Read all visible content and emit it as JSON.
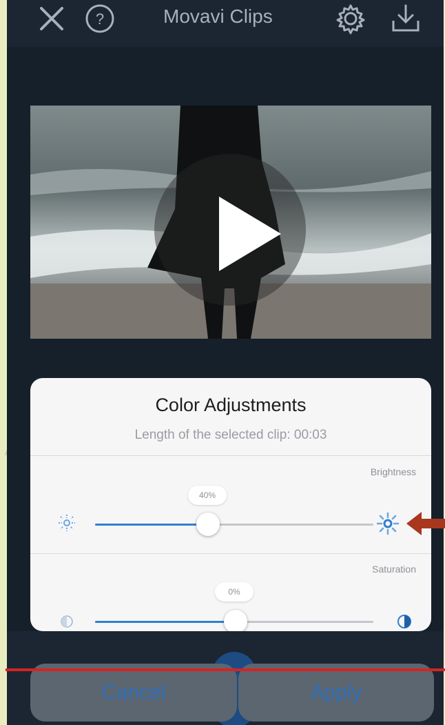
{
  "app": {
    "title": "Movavi Clips"
  },
  "header": {
    "icons": [
      "close-icon",
      "help-icon",
      "gear-icon",
      "download-icon"
    ]
  },
  "video": {
    "play_icon": "play-icon"
  },
  "panel": {
    "title": "Color Adjustments",
    "subtitle": "Length of the selected clip: 00:03",
    "sliders": [
      {
        "label": "Brightness",
        "value_text": "40%",
        "value": 0.4,
        "left_icon": "sun-dim-icon",
        "right_icon": "sun-bright-icon"
      },
      {
        "label": "Saturation",
        "value_text": "0%",
        "value": 0.5,
        "left_icon": "saturation-low-icon",
        "right_icon": "saturation-high-icon"
      }
    ]
  },
  "buttons": {
    "cancel": "Cancel",
    "apply": "Apply"
  },
  "colors": {
    "accent": "#2f7fd0",
    "annotation_red": "#d52424",
    "arrow": "#a8371e"
  }
}
